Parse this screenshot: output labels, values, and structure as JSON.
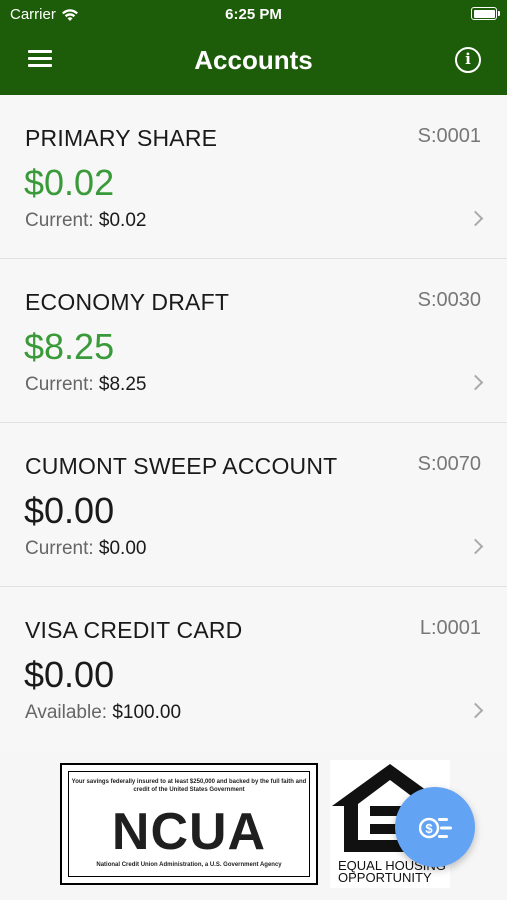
{
  "status_bar": {
    "carrier": "Carrier",
    "time": "6:25 PM"
  },
  "header": {
    "title": "Accounts",
    "menu_icon": "hamburger-menu-icon",
    "info_icon": "info-icon"
  },
  "accounts": [
    {
      "name": "PRIMARY SHARE",
      "id": "S:0001",
      "balance": "$0.02",
      "sub_label": "Current:",
      "sub_value": "$0.02",
      "positive": true
    },
    {
      "name": "ECONOMY DRAFT",
      "id": "S:0030",
      "balance": "$8.25",
      "sub_label": "Current:",
      "sub_value": "$8.25",
      "positive": true
    },
    {
      "name": "CUMONT SWEEP ACCOUNT",
      "id": "S:0070",
      "balance": "$0.00",
      "sub_label": "Current:",
      "sub_value": "$0.00",
      "positive": false
    },
    {
      "name": "VISA CREDIT CARD",
      "id": "L:0001",
      "balance": "$0.00",
      "sub_label": "Available:",
      "sub_value": "$100.00",
      "positive": false
    }
  ],
  "footer": {
    "ncua_top": "Your savings federally insured to at least $250,000 and backed by the full faith and credit of the United States Government",
    "ncua_logo": "NCUA",
    "ncua_bottom": "National Credit Union Administration, a U.S. Government Agency",
    "eho_line1": "EQUAL HOUSING",
    "eho_line2": "OPPORTUNITY"
  },
  "fab": {
    "icon": "transfer-money-icon"
  },
  "colors": {
    "header": "#1d5c09",
    "positive_balance": "#3a9a3a",
    "fab": "#62a3f3"
  }
}
